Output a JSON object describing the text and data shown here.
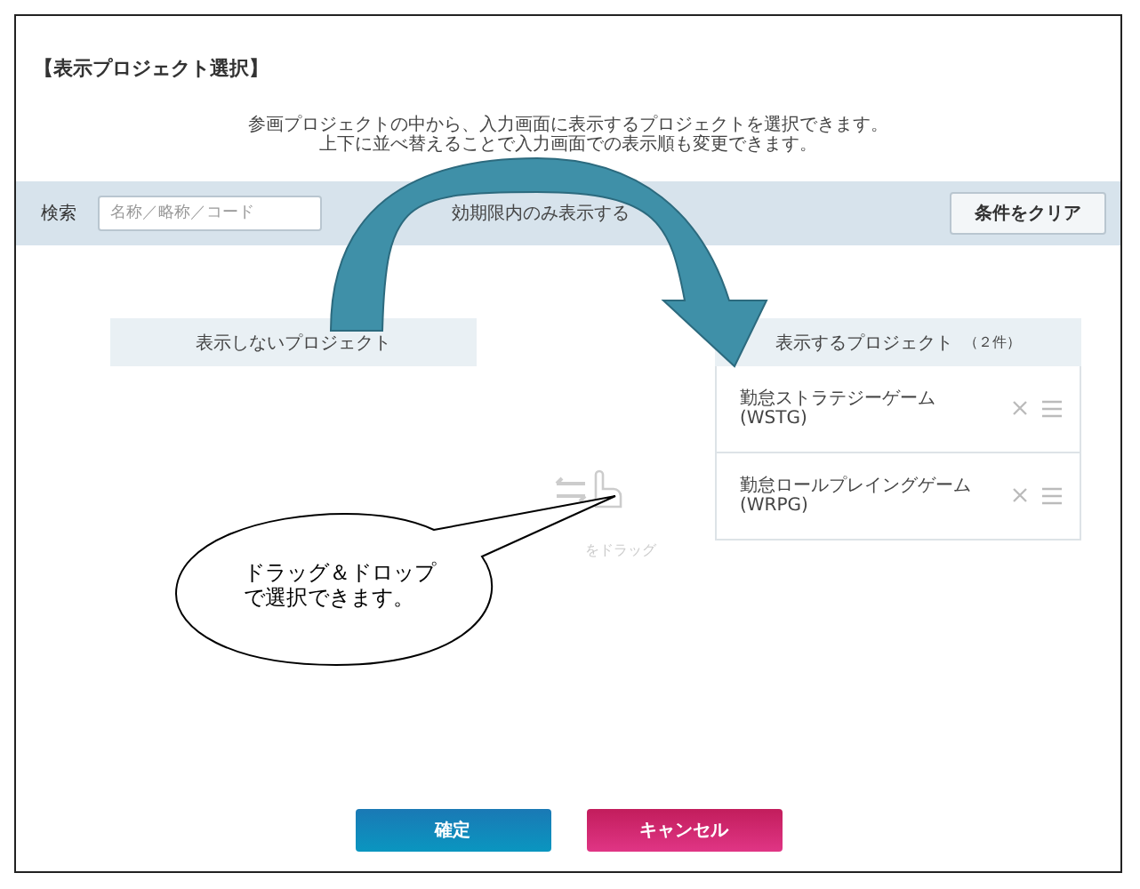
{
  "title": "【表示プロジェクト選択】",
  "description": [
    "参画プロジェクトの中から、入力画面に表示するプロジェクトを選択できます。",
    "上下に並べ替えることで入力画面での表示順も変更できます。"
  ],
  "search": {
    "label": "検索",
    "placeholder": "名称／略称／コード",
    "filter_label": "効期限内のみ表示する",
    "clear_button": "条件をクリア"
  },
  "hidden_panel": {
    "header": "表示しないプロジェクト",
    "drop_hint": "をドラッグ"
  },
  "shown_panel": {
    "header": "表示するプロジェクト",
    "count": "（２件）",
    "items": [
      {
        "name": "勤怠ストラテジーゲーム",
        "code": "(WSTG)"
      },
      {
        "name": "勤怠ロールプレイングゲーム",
        "code": "(WRPG)"
      }
    ]
  },
  "callout": [
    "ドラッグ＆ドロップ",
    "で選択できます。"
  ],
  "buttons": [
    {
      "label": "確定",
      "kind": "primary"
    },
    {
      "label": "キャンセル",
      "kind": "danger"
    }
  ]
}
